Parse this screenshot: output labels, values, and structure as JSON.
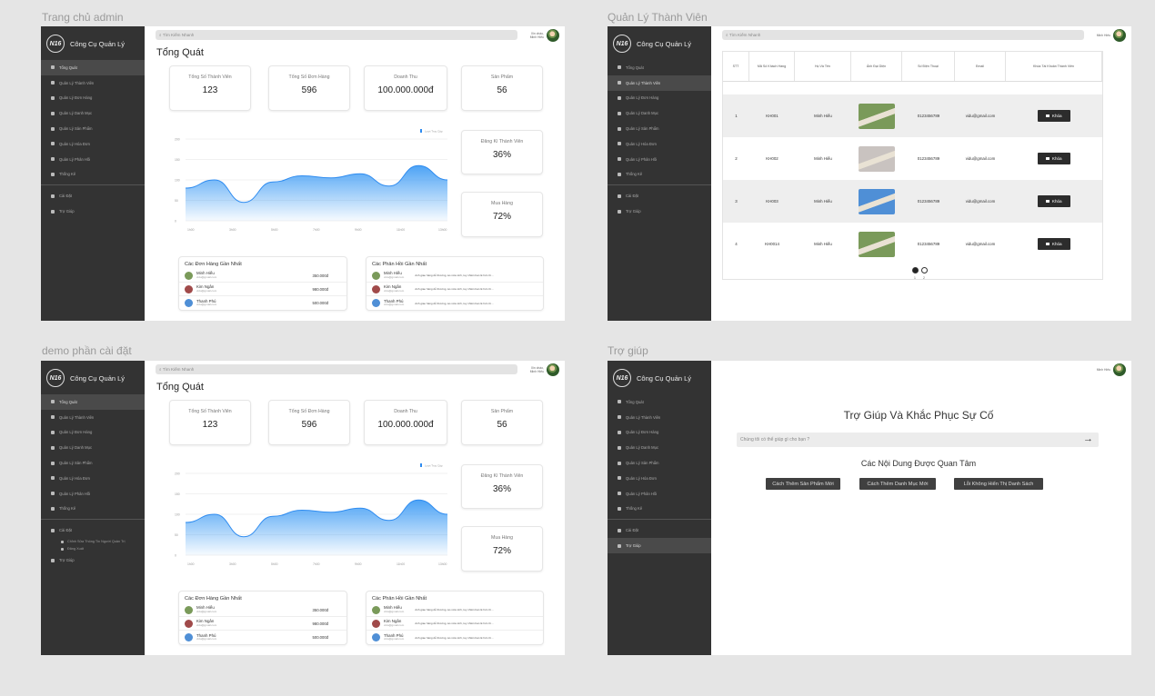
{
  "frames": {
    "admin_home": {
      "label": "Trang chủ admin"
    },
    "members": {
      "label": "Quản Lý Thành Viên"
    },
    "settings_demo": {
      "label": "demo phần cài đặt"
    },
    "help": {
      "label": "Trợ giúp"
    }
  },
  "app": {
    "logo_badge": "N16",
    "logo_text": "Công Cụ Quản Lý",
    "search_placeholder": "Tìm Kiếm Nhanh",
    "user_greeting": "Xin chào,",
    "user_name": "Minh Hiếu",
    "user_name_short": "Minh Hiếu"
  },
  "nav": [
    {
      "label": "Tổng Quát",
      "icon": "dashboard-icon"
    },
    {
      "label": "Quản Lý Thành Viên",
      "icon": "users-icon"
    },
    {
      "label": "Quản Lý Đơn Hàng",
      "icon": "orders-icon"
    },
    {
      "label": "Quản Lý Danh Mục",
      "icon": "category-icon"
    },
    {
      "label": "Quản Lý Sản Phẩm",
      "icon": "product-icon"
    },
    {
      "label": "Quản Lý Hóa Đơn",
      "icon": "invoice-icon"
    },
    {
      "label": "Quản Lý Phản Hồi",
      "icon": "feedback-icon"
    },
    {
      "label": "Thống Kê",
      "icon": "stats-icon"
    },
    {
      "label": "Cài Đặt",
      "icon": "gear-icon"
    },
    {
      "label": "Trợ Giúp",
      "icon": "help-icon"
    }
  ],
  "nav_sub": [
    {
      "label": "Chỉnh Sửa Thông Tin Người Quản Trị"
    },
    {
      "label": "Đăng Xuất"
    }
  ],
  "dashboard": {
    "title": "Tổng Quát",
    "stats": [
      {
        "label": "Tổng Số Thành Viên",
        "value": "123"
      },
      {
        "label": "Tổng Số Đơn Hàng",
        "value": "596"
      },
      {
        "label": "Doanh Thu",
        "value": "100.000.000đ"
      },
      {
        "label": "Sản Phẩm",
        "value": "56"
      }
    ],
    "side_stats": [
      {
        "label": "Đăng Kí Thành Viên",
        "value": "36%"
      },
      {
        "label": "Mua Hàng",
        "value": "72%"
      }
    ],
    "recent_orders": {
      "title": "Các Đơn Hàng Gần Nhất",
      "rows": [
        {
          "name": "Minh Hiếu",
          "email": "vidu@gmail.com",
          "amount": "350.000đ"
        },
        {
          "name": "Kim Ngân",
          "email": "vidu@gmail.com",
          "amount": "980.000đ"
        },
        {
          "name": "Thanh Phú",
          "email": "vidu@gmail.com",
          "amount": "500.000đ"
        }
      ]
    },
    "recent_feedback": {
      "title": "Các Phản Hồi Gần Nhất",
      "rows": [
        {
          "name": "Minh Hiếu",
          "email": "vidu@gmail.com",
          "comment": "Anh giao hàng dễ thương, áo vừa xinh, tuy nhiên ban lê hơi cũ ..."
        },
        {
          "name": "Kim Ngân",
          "email": "vidu@gmail.com",
          "comment": "Anh giao hàng dễ thương, áo vừa xinh, tuy nhiên ban lê hơi cũ ..."
        },
        {
          "name": "Thanh Phú",
          "email": "vidu@gmail.com",
          "comment": "Anh giao hàng dễ thương, áo vừa xinh, tuy nhiên ban lê hơi cũ ..."
        }
      ]
    }
  },
  "members": {
    "columns": [
      "STT",
      "Mã Số Khách Hàng",
      "Họ Và Tên",
      "Ảnh Đại Diện",
      "Số Điện Thoại",
      "Email",
      "Khóa Tài Khoản Thành Viên"
    ],
    "rows": [
      {
        "stt": "1",
        "id": "KH001",
        "name": "Minh Hiếu",
        "phone": "0123456789",
        "email": "vidu@gmail.com",
        "action": "Khóa",
        "photo": "#7a9a5a"
      },
      {
        "stt": "2",
        "id": "KH002",
        "name": "Minh Hiếu",
        "phone": "0123456789",
        "email": "vidu@gmail.com",
        "action": "Khóa",
        "photo": "#c9c3c0"
      },
      {
        "stt": "3",
        "id": "KH003",
        "name": "Minh Hiếu",
        "phone": "0123456789",
        "email": "vidu@gmail.com",
        "action": "Khóa",
        "photo": "#4f8fd6"
      },
      {
        "stt": "4",
        "id": "KH0014",
        "name": "Minh Hiếu",
        "phone": "0123456789",
        "email": "vidu@gmail.com",
        "action": "Khóa",
        "photo": "#7a9a5a"
      }
    ],
    "pages": [
      "1",
      "2"
    ],
    "current_page": 1
  },
  "help": {
    "title": "Trợ Giúp Và Khắc Phục Sự Cố",
    "search_placeholder": "Chúng tôi có thể giúp gì cho bạn ?",
    "topics_title": "Các Nội Dung Được Quan Tâm",
    "topics": [
      "Cách Thêm Sản Phẩm Mới",
      "Cách Thêm Danh Mục Mới",
      "Lỗi Không Hiển Thị Danh Sách"
    ]
  },
  "chart_data": {
    "type": "area",
    "legend": [
      "Lượt Truy Cập"
    ],
    "x": [
      "1h00",
      "3h00",
      "5h00",
      "7h00",
      "9h00",
      "11h00",
      "13h00"
    ],
    "yticks": [
      0,
      50,
      100,
      150,
      200
    ],
    "ylim": [
      0,
      200
    ],
    "series": [
      {
        "name": "Lượt Truy Cập",
        "values": [
          80,
          100,
          45,
          95,
          110,
          105,
          115,
          85,
          135,
          100
        ]
      }
    ],
    "color": "#4da3f5"
  }
}
